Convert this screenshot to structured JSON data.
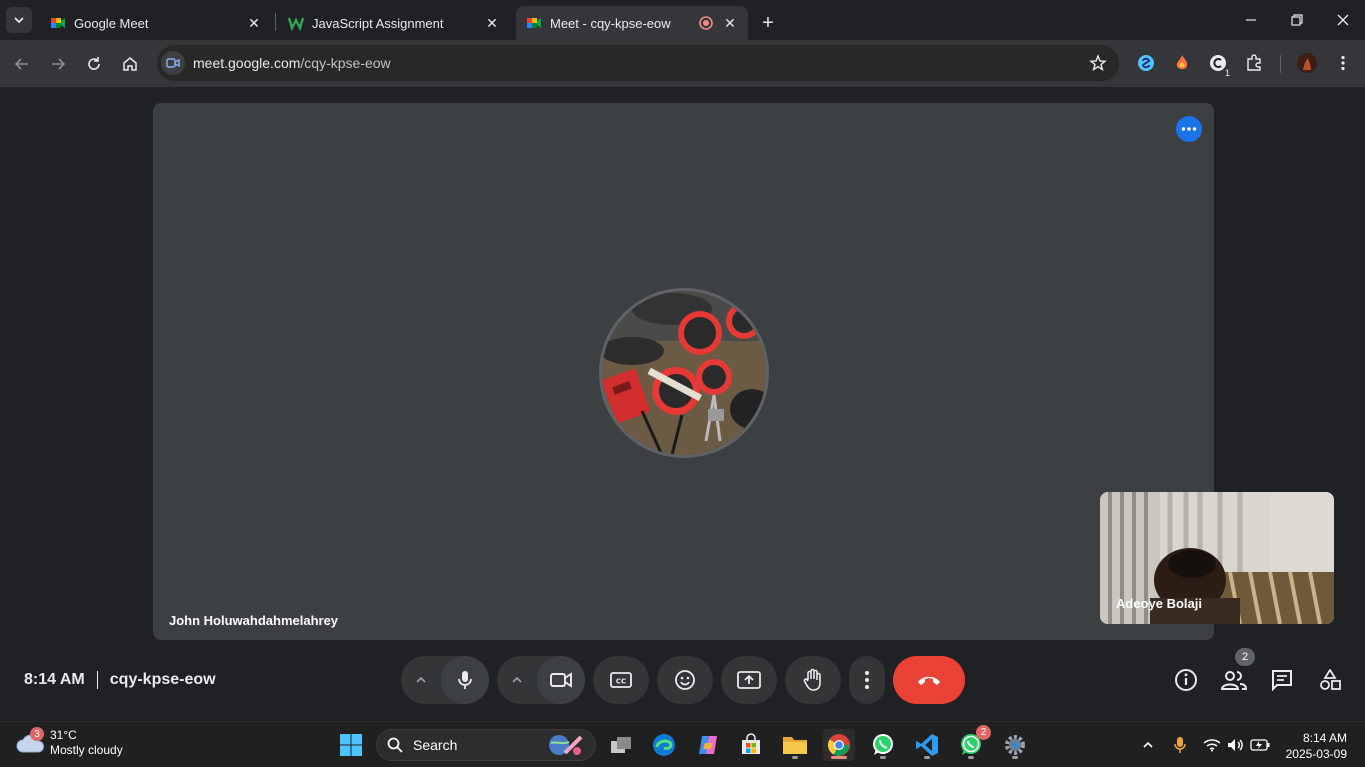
{
  "browser": {
    "tabs": [
      {
        "title": "Google Meet",
        "favicon": "google-meet-icon",
        "active": false
      },
      {
        "title": "JavaScript Assignment",
        "favicon": "assignment-w-icon",
        "active": false
      },
      {
        "title": "Meet - cqy-kpse-eow",
        "favicon": "google-meet-icon",
        "active": true,
        "recording": true
      }
    ],
    "new_tab_label": "+",
    "url_host": "meet.google.com",
    "url_path": "/cqy-kpse-eow",
    "extension_badge": "1"
  },
  "meet": {
    "main_participant_name": "John Holuwahdahmelahrey",
    "self_participant_name": "Adeoye Bolaji",
    "time": "8:14 AM",
    "meeting_code": "cqy-kpse-eow",
    "people_count": "2",
    "colors": {
      "hangup": "#ea4335",
      "accent": "#1a73e8",
      "stage": "#3c4043"
    }
  },
  "taskbar": {
    "weather_temp": "31°C",
    "weather_desc": "Mostly cloudy",
    "weather_badge": "3",
    "search_label": "Search",
    "whatsapp_badge": "2",
    "clock_time": "8:14 AM",
    "clock_date": "2025-03-09"
  }
}
